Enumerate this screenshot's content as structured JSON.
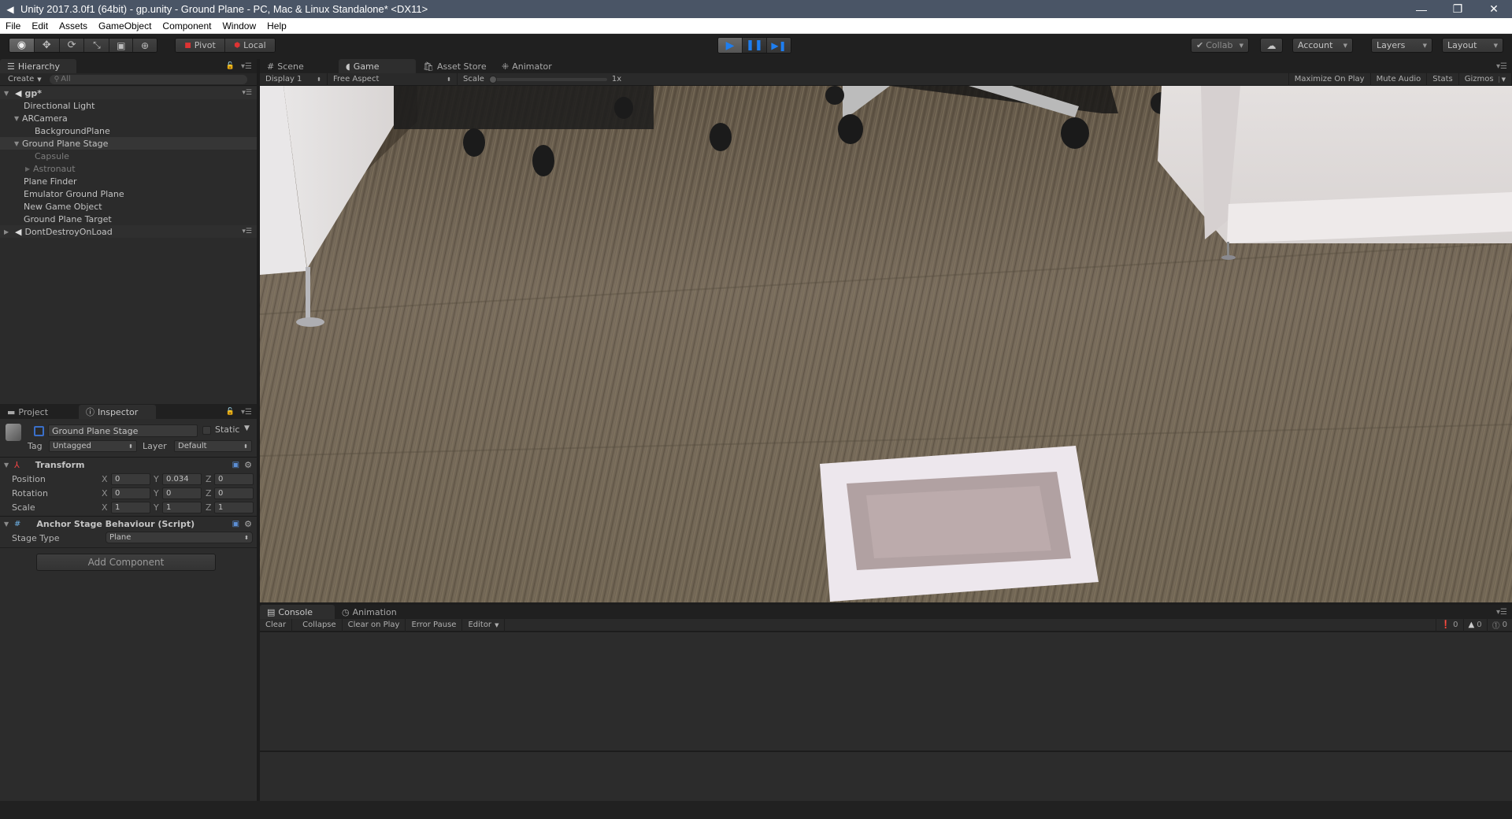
{
  "window": {
    "title": "Unity 2017.3.0f1 (64bit) - gp.unity - Ground Plane - PC, Mac & Linux Standalone* <DX11>",
    "controls": [
      "minimize",
      "restore",
      "close"
    ]
  },
  "menu": [
    "File",
    "Edit",
    "Assets",
    "GameObject",
    "Component",
    "Window",
    "Help"
  ],
  "toolbar": {
    "tools": [
      {
        "name": "view-tool",
        "icon": "eye-icon",
        "active": true
      },
      {
        "name": "move-tool",
        "icon": "move-arrows-icon",
        "active": false
      },
      {
        "name": "rotate-tool",
        "icon": "rotate-icon",
        "active": false
      },
      {
        "name": "scale-tool",
        "icon": "scale-icon",
        "active": false
      },
      {
        "name": "rect-tool",
        "icon": "rect-icon",
        "active": false
      },
      {
        "name": "transform-tool",
        "icon": "transform-icon",
        "active": false
      }
    ],
    "pivot_label": "Pivot",
    "local_label": "Local",
    "playback": {
      "playing": true,
      "paused": true
    },
    "collab_label": "Collab",
    "account_label": "Account",
    "layers_label": "Layers",
    "layout_label": "Layout",
    "accent": "#1a6fd6"
  },
  "hierarchy": {
    "tab_label": "Hierarchy",
    "create_label": "Create",
    "search_placeholder": "All",
    "items": [
      {
        "label": "gp*",
        "depth": 0,
        "type": "scene",
        "expanded": true
      },
      {
        "label": "Directional Light",
        "depth": 1
      },
      {
        "label": "ARCamera",
        "depth": 1,
        "expanded": true
      },
      {
        "label": "BackgroundPlane",
        "depth": 2
      },
      {
        "label": "Ground Plane Stage",
        "depth": 1,
        "expanded": true,
        "selected": true
      },
      {
        "label": "Capsule",
        "depth": 2,
        "inactive": true
      },
      {
        "label": "Astronaut",
        "depth": 2,
        "inactive": true,
        "collapsed": true
      },
      {
        "label": "Plane Finder",
        "depth": 1
      },
      {
        "label": "Emulator Ground Plane",
        "depth": 1
      },
      {
        "label": "New Game Object",
        "depth": 1
      },
      {
        "label": "Ground Plane Target",
        "depth": 1
      },
      {
        "label": "DontDestroyOnLoad",
        "depth": 0,
        "type": "scene",
        "expanded": false
      }
    ]
  },
  "inspector": {
    "tabs": [
      {
        "label": "Project",
        "active": false
      },
      {
        "label": "Inspector",
        "active": true
      }
    ],
    "object_name": "Ground Plane Stage",
    "active": true,
    "static_label": "Static",
    "tag_label": "Tag",
    "tag_value": "Untagged",
    "layer_label": "Layer",
    "layer_value": "Default",
    "transform": {
      "title": "Transform",
      "rows": [
        {
          "label": "Position",
          "x": "0",
          "y": "0.034",
          "z": "0"
        },
        {
          "label": "Rotation",
          "x": "0",
          "y": "0",
          "z": "0"
        },
        {
          "label": "Scale",
          "x": "1",
          "y": "1",
          "z": "1"
        }
      ]
    },
    "script": {
      "title": "Anchor Stage Behaviour (Script)",
      "field_label": "Stage Type",
      "field_value": "Plane"
    },
    "add_component_label": "Add Component"
  },
  "center_tabs": [
    {
      "label": "Scene",
      "icon": "grid-icon",
      "active": false
    },
    {
      "label": "Game",
      "icon": "pacman-icon",
      "active": true
    },
    {
      "label": "Asset Store",
      "icon": "store-bag-icon",
      "active": false
    },
    {
      "label": "Animator",
      "icon": "animator-icon",
      "active": false
    }
  ],
  "game_bar": {
    "display": "Display 1",
    "aspect": "Free Aspect",
    "scale_label": "Scale",
    "scale_value": "1x",
    "scale_fraction": 0.0,
    "maximize_on_play": "Maximize On Play",
    "mute_audio": "Mute Audio",
    "stats": "Stats",
    "gizmos": "Gizmos"
  },
  "console": {
    "tabs": [
      {
        "label": "Console",
        "active": true
      },
      {
        "label": "Animation",
        "active": false
      }
    ],
    "buttons": [
      "Clear",
      "Collapse",
      "Clear on Play",
      "Error Pause",
      "Editor"
    ],
    "counts": {
      "info": "0",
      "warnings": "0",
      "errors": "0"
    }
  }
}
